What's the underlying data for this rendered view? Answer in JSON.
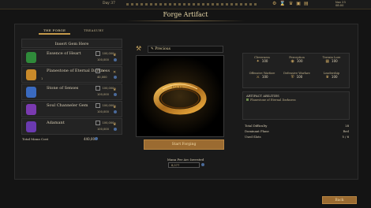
{
  "topbar": {
    "day": "Day 37",
    "date_line1": "Nov 23",
    "date_line2": "08:00"
  },
  "title": "Forge Artifact",
  "tabs": [
    {
      "label": "THE FORGE",
      "active": true
    },
    {
      "label": "TREASURY",
      "active": false
    }
  ],
  "materials": {
    "insert_label": "Insert Gem Here",
    "rows": [
      {
        "name": "Essence of Heart",
        "qty": "100,000",
        "cost": "100,000",
        "color": "#2f8a3a",
        "icon": "green-gem-icon"
      },
      {
        "name": "Planestone of Eternal Darkness",
        "qty": "1",
        "cost": "40,000",
        "color": "#c98a2a",
        "icon": "planestone-icon",
        "num": "1"
      },
      {
        "name": "Stone of Senses",
        "qty": "100,000",
        "cost": "100,000",
        "color": "#3a6ac0",
        "icon": "blue-gem-icon"
      },
      {
        "name": "Soul Channeler Gem",
        "qty": "100,000",
        "cost": "100,000",
        "color": "#7a3ab0",
        "icon": "purple-gem-icon"
      },
      {
        "name": "Adamant",
        "qty": "100,000",
        "cost": "100,000",
        "color": "#6a3ab0",
        "icon": "adamant-icon"
      }
    ],
    "total_label": "Total Mana Cost",
    "total_value": "440,000"
  },
  "artifact": {
    "name": "Precious",
    "forge_button": "Start Forging",
    "mana_label": "Mana Per Arc Invested",
    "mana_value": "8,077"
  },
  "stats": [
    {
      "label": "Cleverness",
      "value": "100",
      "icon": "lightbulb-icon"
    },
    {
      "label": "Perception",
      "value": "100",
      "icon": "eye-icon"
    },
    {
      "label": "Terrain Lore",
      "value": "100",
      "icon": "map-icon"
    },
    {
      "label": "Offensive Warfare",
      "value": "100",
      "icon": "sword-icon"
    },
    {
      "label": "Defensive Warfare",
      "value": "100",
      "icon": "shield-icon"
    },
    {
      "label": "Leadership",
      "value": "100",
      "icon": "crown-icon"
    }
  ],
  "abilities": {
    "header": "ARTIFACT ABILITIES",
    "items": [
      "Planestone of Eternal Darkness"
    ]
  },
  "summary": [
    {
      "label": "Total Difficulty",
      "value": "18"
    },
    {
      "label": "Dominant Plane",
      "value": "Red"
    },
    {
      "label": "Used Slots",
      "value": "5 / 6"
    }
  ],
  "back_button": "Back"
}
